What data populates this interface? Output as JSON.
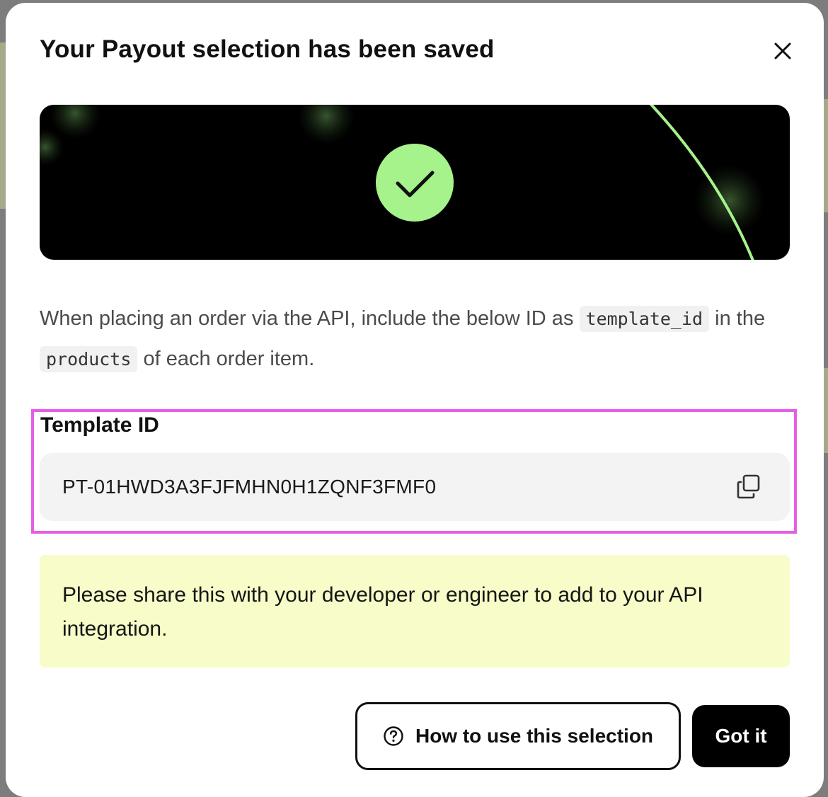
{
  "modal": {
    "title": "Your Payout selection has been saved"
  },
  "instructions": {
    "part1": "When placing an order via the API, include the below ID as",
    "code1": "template_id",
    "part2": "in the",
    "code2": "products",
    "part3": "of each order item."
  },
  "template": {
    "label": "Template ID",
    "value": "PT-01HWD3A3FJFMHN0H1ZQNF3FMF0"
  },
  "notice": {
    "text": "Please share this with your developer or engineer to add to your API integration."
  },
  "actions": {
    "secondary_label": "How to use this selection",
    "primary_label": "Got it"
  },
  "colors": {
    "accent_green": "#a6f28b",
    "notice_bg": "#f7fcc8",
    "highlight_border": "#e55ee8",
    "field_bg": "#f3f3f3"
  },
  "icons": {
    "close": "close-icon",
    "success": "checkmark-icon",
    "copy": "copy-icon",
    "help": "question-circle-icon"
  }
}
